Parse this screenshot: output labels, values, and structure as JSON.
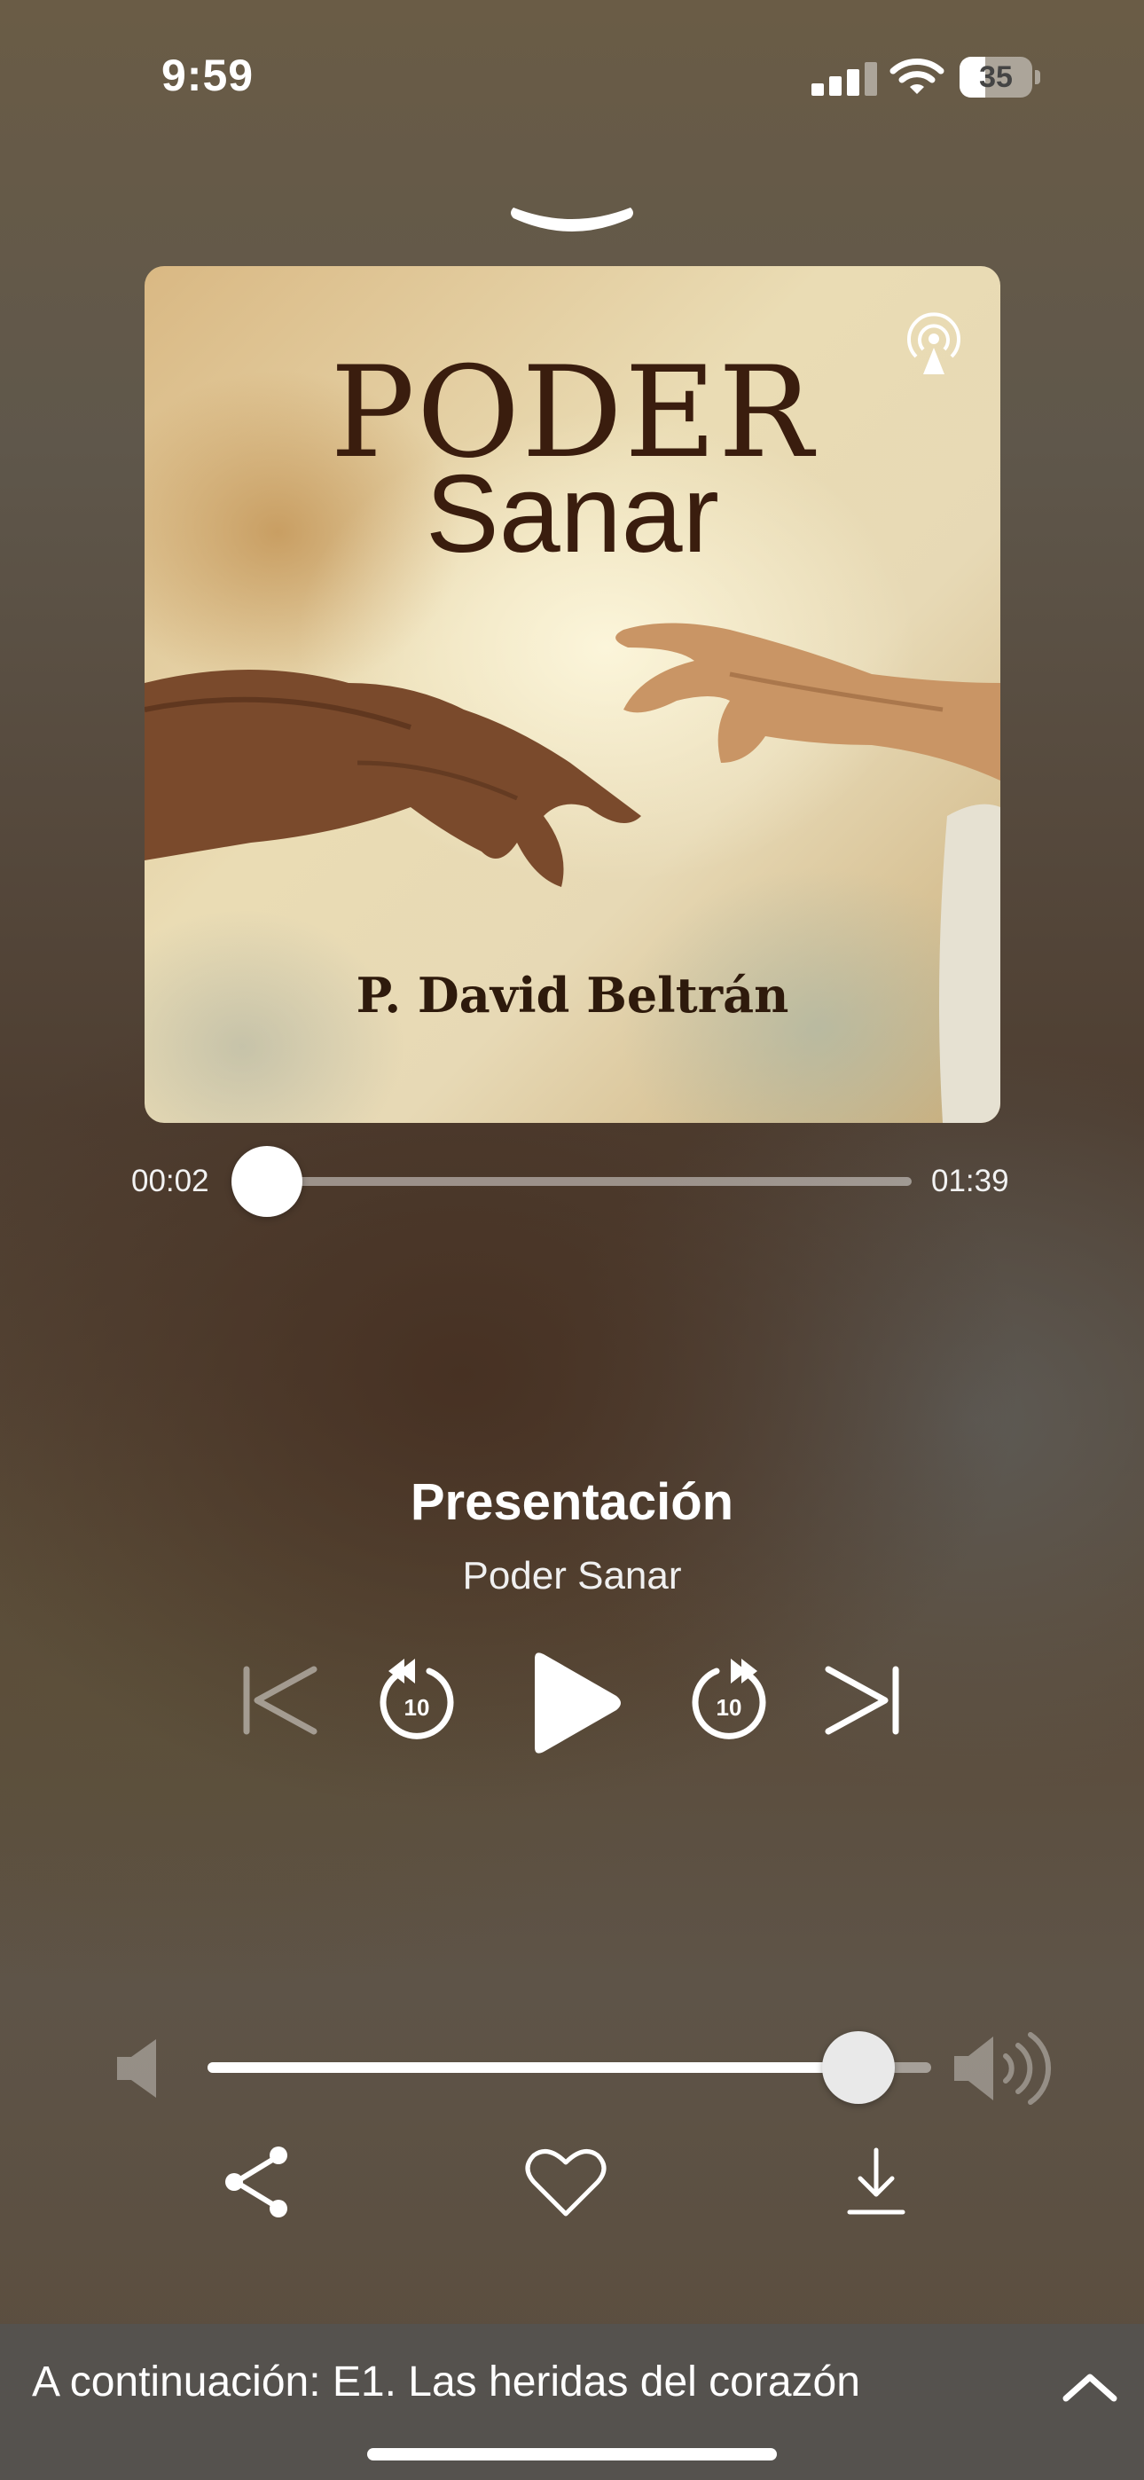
{
  "status_bar": {
    "time": "9:59",
    "battery_level": "35",
    "icons": [
      "cellular-signal-icon",
      "wifi-icon",
      "battery-icon"
    ]
  },
  "header": {
    "icons": [
      "dismiss-chevron-icon"
    ]
  },
  "artwork": {
    "title": "PODER",
    "subtitle": "Sanar",
    "author": "P. David Beltrán",
    "icons": [
      "podcast-broadcast-icon"
    ]
  },
  "progress": {
    "elapsed": "00:02",
    "total": "01:39",
    "fraction": 0.02
  },
  "track": {
    "title": "Presentación",
    "album": "Poder Sanar"
  },
  "controls": {
    "icons": [
      "previous-track-icon",
      "rewind-10-icon",
      "play-icon",
      "forward-10-icon",
      "next-track-icon"
    ],
    "rewind_seconds": "10",
    "forward_seconds": "10"
  },
  "volume": {
    "level": 0.9,
    "icons": [
      "volume-min-icon",
      "volume-max-icon"
    ]
  },
  "actions": {
    "icons": [
      "share-icon",
      "heart-icon",
      "download-icon"
    ]
  },
  "up_next": {
    "text": "A continuación: E1. Las heridas del corazón",
    "icons": [
      "chevron-up-icon"
    ]
  },
  "colors": {
    "accent": "#ffffff",
    "artwork_text": "#3a1d0e",
    "up_next_bar": "#55524e"
  }
}
